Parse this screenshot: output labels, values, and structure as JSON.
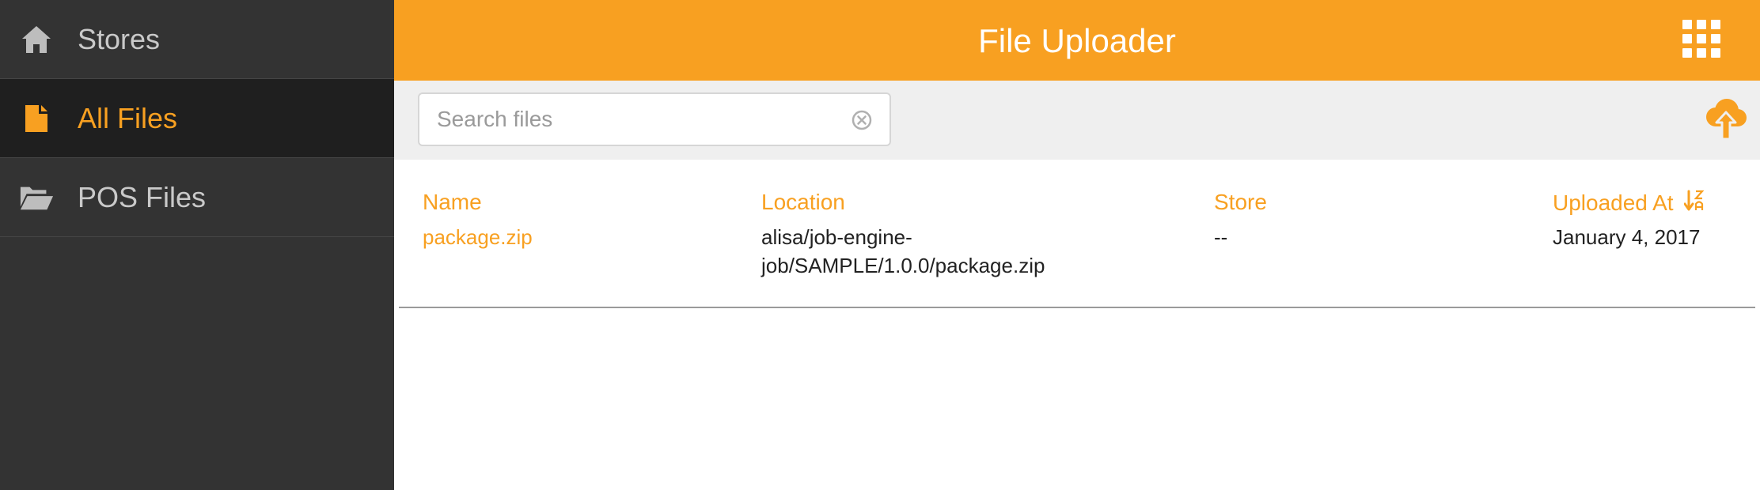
{
  "sidebar": {
    "items": [
      {
        "label": "Stores",
        "icon": "home-icon",
        "active": false
      },
      {
        "label": "All Files",
        "icon": "file-icon",
        "active": true
      },
      {
        "label": "POS Files",
        "icon": "folder-open-icon",
        "active": false
      }
    ]
  },
  "header": {
    "title": "File Uploader",
    "apps_icon": "grid-apps-icon"
  },
  "toolbar": {
    "search_placeholder": "Search files",
    "search_value": "",
    "clear_icon": "clear-circle-icon",
    "upload_icon": "cloud-upload-icon"
  },
  "table": {
    "columns": [
      "Name",
      "Location",
      "Store",
      "Uploaded At"
    ],
    "sort_icon": "sort-alpha-desc-icon",
    "rows": [
      {
        "name": "package.zip",
        "location": "alisa/job-engine-job/SAMPLE/1.0.0/package.zip",
        "store": "--",
        "uploaded_at": "January 4, 2017"
      }
    ]
  },
  "colors": {
    "accent": "#f8a021",
    "sidebar_bg": "#333333",
    "sidebar_active_bg": "#1f1f1f",
    "toolbar_bg": "#efefef"
  }
}
